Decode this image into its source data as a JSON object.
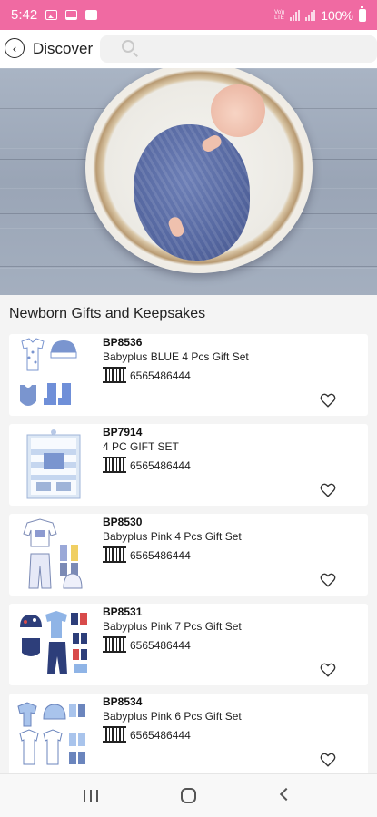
{
  "status_bar": {
    "time": "5:42",
    "network": "Vo)) LTE",
    "battery": "100%",
    "icons": [
      "image-icon",
      "laptop-icon",
      "message-icon",
      "signal-icon",
      "battery-icon"
    ]
  },
  "header": {
    "title": "Discover",
    "search_placeholder": ""
  },
  "section": {
    "title": "Newborn Gifts and Keepsakes"
  },
  "products": [
    {
      "code": "BP8536",
      "name": "Babyplus BLUE 4 Pcs Gift Set",
      "barcode": "6565486444"
    },
    {
      "code": "BP7914",
      "name": "4 PC GIFT SET",
      "barcode": "6565486444"
    },
    {
      "code": "BP8530",
      "name": "Babyplus Pink 4 Pcs Gift Set",
      "barcode": "6565486444"
    },
    {
      "code": "BP8531",
      "name": "Babyplus Pink 7 Pcs Gift Set",
      "barcode": "6565486444"
    },
    {
      "code": "BP8534",
      "name": "Babyplus Pink 6 Pcs Gift Set",
      "barcode": "6565486444"
    }
  ],
  "colors": {
    "status_bar": "#f06aa2",
    "background": "#f4f4f4",
    "card": "#ffffff",
    "accent_blue": "#6f8fd8"
  }
}
